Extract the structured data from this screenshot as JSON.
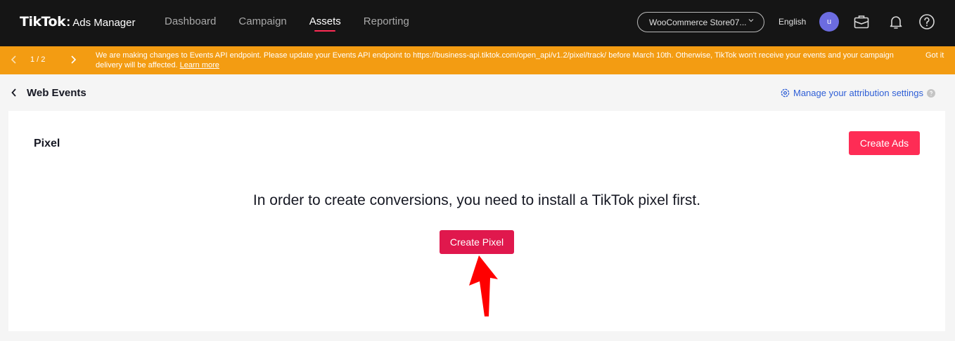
{
  "brand": {
    "name": "TikTok",
    "separator": ":",
    "product": "Ads Manager"
  },
  "nav": {
    "items": [
      {
        "label": "Dashboard",
        "active": false
      },
      {
        "label": "Campaign",
        "active": false
      },
      {
        "label": "Assets",
        "active": true
      },
      {
        "label": "Reporting",
        "active": false
      }
    ]
  },
  "account": {
    "selected": "WooCommerce Store07..."
  },
  "language": "English",
  "user": {
    "initial": "u"
  },
  "icons": {
    "briefcase": "briefcase-icon",
    "bell": "bell-icon",
    "help": "help-icon"
  },
  "banner": {
    "page": "1 / 2",
    "message": "We are making changes to Events API endpoint. Please update your Events API endpoint to https://business-api.tiktok.com/open_api/v1.2/pixel/track/ before March 10th. Otherwise, TikTok won't receive your events and your campaign delivery will be affected.",
    "learn_more": "Learn more",
    "dismiss": "Got it"
  },
  "header": {
    "title": "Web Events",
    "attribution_link": "Manage your attribution settings"
  },
  "card": {
    "title": "Pixel",
    "create_ads_label": "Create Ads",
    "empty_message": "In order to create conversions, you need to install a TikTok pixel first.",
    "create_pixel_label": "Create Pixel"
  },
  "colors": {
    "topbar": "#151515",
    "banner": "#f39c12",
    "primary": "#fe2c55",
    "link": "#2f5fd6",
    "annotation_arrow": "#ff0000"
  }
}
